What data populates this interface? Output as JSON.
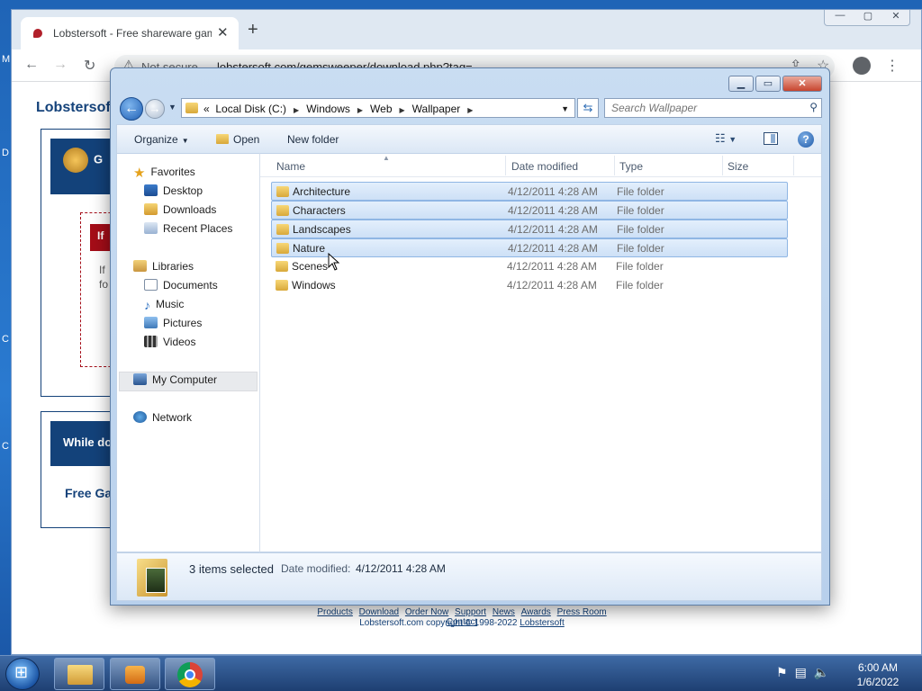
{
  "desktop": {
    "edge_letters": [
      "D",
      "C",
      "C",
      "M"
    ]
  },
  "browser": {
    "tab_title": "Lobstersoft - Free shareware gam",
    "tab_close": "✕",
    "new_tab": "+",
    "not_secure": "Not secure",
    "url": "lobstersoft.com/gemsweeper/download.php?tag=",
    "win_min": "—",
    "win_max": "▢",
    "win_close": "✕"
  },
  "page": {
    "title": "Lobstersoft",
    "banner1": "G",
    "red_tag": "If",
    "text1": "If",
    "text2": "fo",
    "banner2": "While do",
    "free_games": "Free Ga",
    "footer_links": [
      "Products",
      "Download",
      "Order Now",
      "Support",
      "News",
      "Awards",
      "Press Room",
      "Contact"
    ],
    "copyright": "Lobstersoft.com copyright © 1998-2022 ",
    "copyright_link": "Lobstersoft"
  },
  "explorer": {
    "address": [
      "Local Disk (C:)",
      "Windows",
      "Web",
      "Wallpaper"
    ],
    "address_prefix": "«",
    "search_placeholder": "Search Wallpaper",
    "commands": {
      "organize": "Organize",
      "open": "Open",
      "new_folder": "New folder"
    },
    "nav": {
      "favorites": "Favorites",
      "desktop": "Desktop",
      "downloads": "Downloads",
      "recent_places": "Recent Places",
      "libraries": "Libraries",
      "documents": "Documents",
      "music": "Music",
      "pictures": "Pictures",
      "videos": "Videos",
      "my_computer": "My Computer",
      "network": "Network"
    },
    "columns": {
      "name": "Name",
      "date": "Date modified",
      "type": "Type",
      "size": "Size"
    },
    "files": [
      {
        "name": "Architecture",
        "date": "4/12/2011 4:28 AM",
        "type": "File folder",
        "selected": true
      },
      {
        "name": "Characters",
        "date": "4/12/2011 4:28 AM",
        "type": "File folder",
        "selected": true
      },
      {
        "name": "Landscapes",
        "date": "4/12/2011 4:28 AM",
        "type": "File folder",
        "selected": true
      },
      {
        "name": "Nature",
        "date": "4/12/2011 4:28 AM",
        "type": "File folder",
        "selected": true
      },
      {
        "name": "Scenes",
        "date": "4/12/2011 4:28 AM",
        "type": "File folder",
        "selected": false
      },
      {
        "name": "Windows",
        "date": "4/12/2011 4:28 AM",
        "type": "File folder",
        "selected": false
      }
    ],
    "details": {
      "selection": "3 items selected",
      "date_label": "Date modified:",
      "date_value": "4/12/2011 4:28 AM"
    }
  },
  "taskbar": {
    "time": "6:00 AM",
    "date": "1/6/2022"
  }
}
